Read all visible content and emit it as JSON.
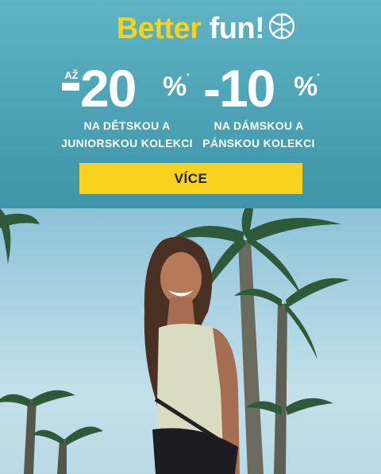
{
  "headline": {
    "part1": "Better",
    "part2": "fun!"
  },
  "offers": [
    {
      "prefix": "AŽ",
      "value": "-20",
      "percent": "%",
      "mark": "*",
      "line1": "NA DĚTSKOU A",
      "line2": "JUNIORSKOU KOLEKCI"
    },
    {
      "value": "-10",
      "percent": "%",
      "mark": "*",
      "line1": "NA DÁMSKOU A",
      "line2": "PÁNSKOU KOLEKCI"
    }
  ],
  "cta": {
    "label": "VÍCE"
  },
  "colors": {
    "accent_yellow": "#f6d31c",
    "banner_teal": "#4aa1b3",
    "button_yellow": "#f8d21e"
  },
  "icons": {
    "headline_icon": "basketball-icon"
  },
  "image": {
    "subject": "smiling-woman-with-palm-trees"
  }
}
